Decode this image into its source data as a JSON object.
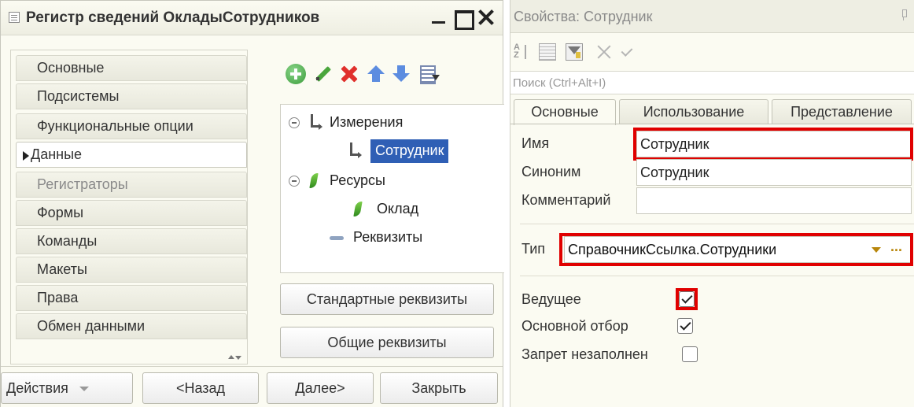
{
  "left_window": {
    "title": "Регистр сведений ОкладыСотрудников",
    "nav_items": [
      {
        "label": "Основные"
      },
      {
        "label": "Подсистемы"
      },
      {
        "label": "Функциональные опции"
      },
      {
        "label": "Данные"
      },
      {
        "label": "Регистраторы"
      },
      {
        "label": "Формы"
      },
      {
        "label": "Команды"
      },
      {
        "label": "Макеты"
      },
      {
        "label": "Права"
      },
      {
        "label": "Обмен данными"
      }
    ],
    "active_nav": "Данные",
    "disabled_nav": "Регистраторы",
    "toolbar_icons": [
      "add-icon",
      "edit-icon",
      "delete-icon",
      "move-up-icon",
      "move-down-icon",
      "list-icon"
    ],
    "tree": {
      "dimensions": "Измерения",
      "dimension_item": "Сотрудник",
      "resources": "Ресурсы",
      "resource_item": "Оклад",
      "attributes": "Реквизиты"
    },
    "buttons": {
      "standard_attributes": "Стандартные реквизиты",
      "common_attributes": "Общие реквизиты"
    },
    "bottom": {
      "actions": "Действия",
      "back": "<Назад",
      "next": "Далее>",
      "close": "Закрыть"
    }
  },
  "properties": {
    "title": "Свойства: Сотрудник",
    "search_placeholder": "Поиск (Ctrl+Alt+I)",
    "tabs": [
      "Основные",
      "Использование",
      "Представление"
    ],
    "active_tab": "Основные",
    "name_label": "Имя",
    "name_value": "Сотрудник",
    "synonym_label": "Синоним",
    "synonym_value": "Сотрудник",
    "comment_label": "Комментарий",
    "comment_value": "",
    "type_label": "Тип",
    "type_value": "СправочникСсылка.Сотрудники",
    "type_more": "...",
    "flags": [
      {
        "label": "Ведущее",
        "checked": true
      },
      {
        "label": "Основной отбор",
        "checked": true
      },
      {
        "label": "Запрет незаполнен",
        "checked": false
      }
    ]
  },
  "colors": {
    "highlight_red": "#e00000",
    "selection_blue": "#2f5fb5",
    "panel_bg": "#fbfbf2"
  }
}
